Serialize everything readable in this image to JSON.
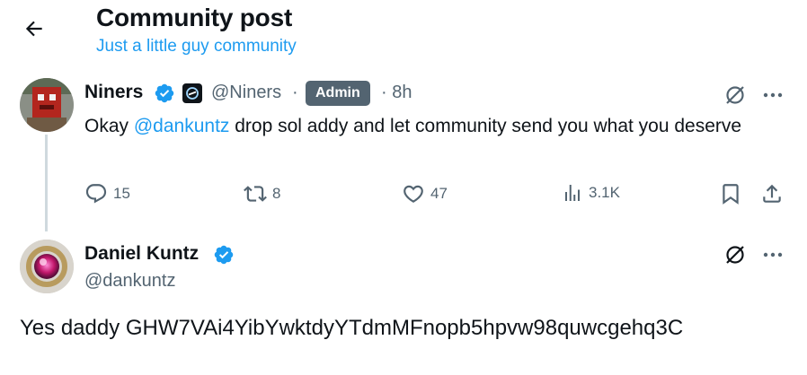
{
  "header": {
    "title": "Community post",
    "community_name": "Just a little guy community"
  },
  "posts": [
    {
      "display_name": "Niners",
      "handle": "@Niners",
      "separator": "·",
      "badge": "Admin",
      "time": "· 8h",
      "text_before": "Okay ",
      "mention": "@dankuntz",
      "text_after": " drop sol addy and let community send you what you deserve",
      "metrics": {
        "replies": "15",
        "reposts": "8",
        "likes": "47",
        "views": "3.1K"
      }
    },
    {
      "display_name": "Daniel Kuntz",
      "handle": "@dankuntz",
      "text": "Yes daddy GHW7VAi4YibYwktdyYTdmMFnopb5hpvw98quwcgehq3C"
    }
  ],
  "colors": {
    "accent": "#1d9bf0",
    "secondary_text": "#536471",
    "badge_bg": "#536471"
  },
  "icons": {
    "back": "arrow-left-icon",
    "verified": "verified-badge-icon",
    "grok": "grok-icon",
    "more": "more-icon",
    "reply": "reply-icon",
    "repost": "repost-icon",
    "like": "heart-icon",
    "views": "views-icon",
    "bookmark": "bookmark-icon",
    "share": "share-icon"
  }
}
